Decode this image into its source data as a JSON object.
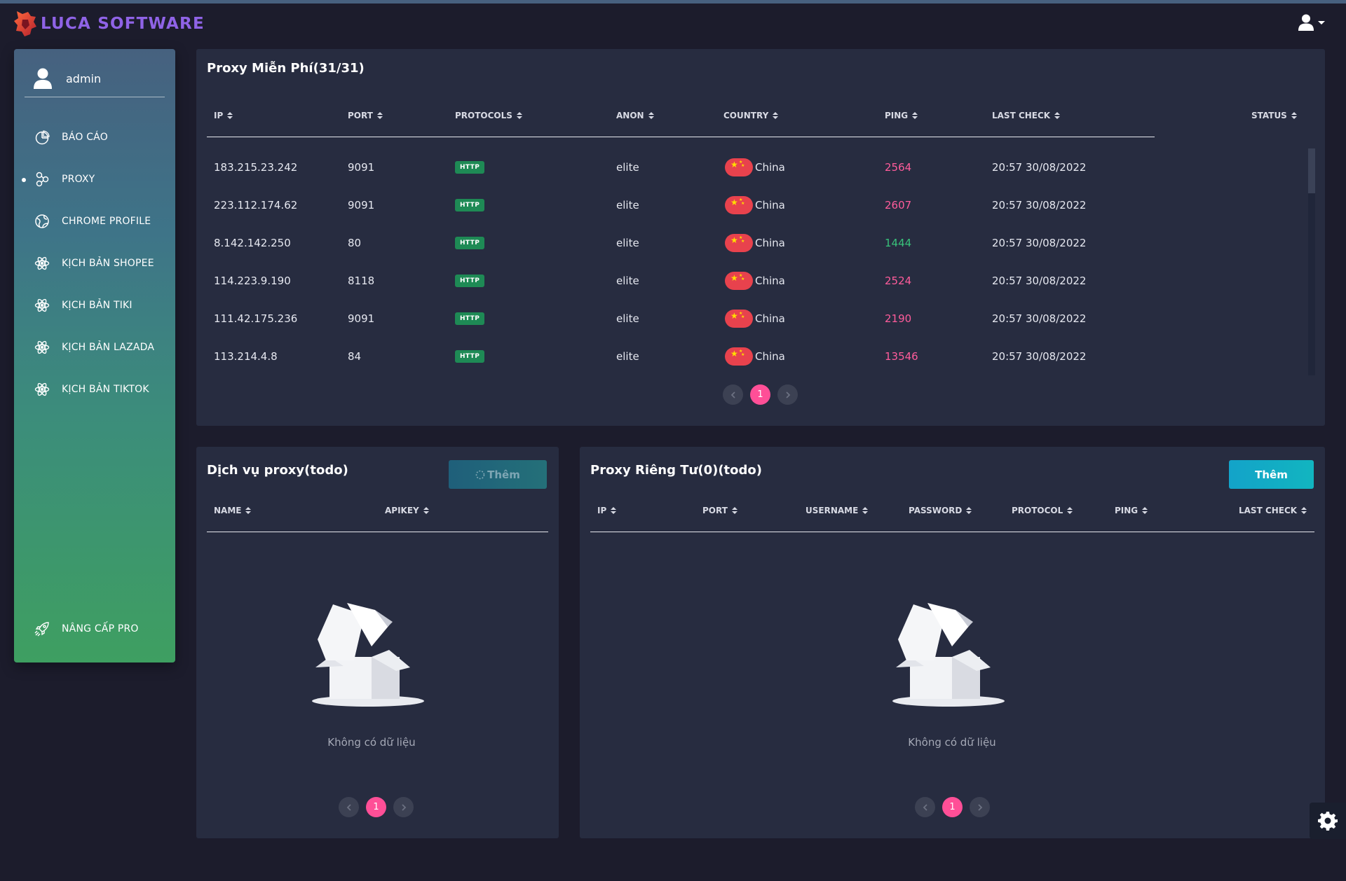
{
  "app": {
    "brand": "LUCA SOFTWARE"
  },
  "user": {
    "name": "admin"
  },
  "sidebar": {
    "items": [
      {
        "label": "BÁO CÁO",
        "icon": "chart-pie-icon",
        "active": false
      },
      {
        "label": "PROXY",
        "icon": "proxy-icon",
        "active": true
      },
      {
        "label": "CHROME PROFILE",
        "icon": "globe-icon",
        "active": false
      },
      {
        "label": "KỊCH BẢN SHOPEE",
        "icon": "atom-icon",
        "active": false
      },
      {
        "label": "KỊCH BẢN TIKI",
        "icon": "atom-icon",
        "active": false
      },
      {
        "label": "KỊCH BẢN LAZADA",
        "icon": "atom-icon",
        "active": false
      },
      {
        "label": "KỊCH BẢN TIKTOK",
        "icon": "atom-icon",
        "active": false
      }
    ],
    "pro": {
      "label": "NÂNG CẤP PRO",
      "icon": "rocket-icon"
    }
  },
  "free_proxy": {
    "title": "Proxy Miễn Phí(31/31)",
    "columns": [
      "IP",
      "PORT",
      "PROTOCOLS",
      "ANON",
      "COUNTRY",
      "PING",
      "LAST CHECK",
      "STATUS"
    ],
    "rows": [
      {
        "ip": "183.215.23.242",
        "port": "9091",
        "protocol": "HTTP",
        "anon": "elite",
        "country": "China",
        "ping": "2564",
        "ping_status": "slow",
        "last_check": "20:57 30/08/2022"
      },
      {
        "ip": "223.112.174.62",
        "port": "9091",
        "protocol": "HTTP",
        "anon": "elite",
        "country": "China",
        "ping": "2607",
        "ping_status": "slow",
        "last_check": "20:57 30/08/2022"
      },
      {
        "ip": "8.142.142.250",
        "port": "80",
        "protocol": "HTTP",
        "anon": "elite",
        "country": "China",
        "ping": "1444",
        "ping_status": "fast",
        "last_check": "20:57 30/08/2022"
      },
      {
        "ip": "114.223.9.190",
        "port": "8118",
        "protocol": "HTTP",
        "anon": "elite",
        "country": "China",
        "ping": "2524",
        "ping_status": "slow",
        "last_check": "20:57 30/08/2022"
      },
      {
        "ip": "111.42.175.236",
        "port": "9091",
        "protocol": "HTTP",
        "anon": "elite",
        "country": "China",
        "ping": "2190",
        "ping_status": "slow",
        "last_check": "20:57 30/08/2022"
      },
      {
        "ip": "113.214.4.8",
        "port": "84",
        "protocol": "HTTP",
        "anon": "elite",
        "country": "China",
        "ping": "13546",
        "ping_status": "slow",
        "last_check": "20:57 30/08/2022"
      }
    ],
    "pagination": {
      "current": "1"
    }
  },
  "proxy_service": {
    "title": "Dịch vụ proxy(todo)",
    "add_label": "Thêm",
    "columns": [
      "NAME",
      "APIKEY"
    ],
    "empty_text": "Không có dữ liệu",
    "pagination": {
      "current": "1"
    }
  },
  "private_proxy": {
    "title": "Proxy Riêng Tư(0)(todo)",
    "add_label": "Thêm",
    "columns": [
      "IP",
      "PORT",
      "USERNAME",
      "PASSWORD",
      "PROTOCOL",
      "PING",
      "LAST CHECK"
    ],
    "empty_text": "Không có dữ liệu",
    "pagination": {
      "current": "1"
    }
  },
  "colors": {
    "background": "#1c1c2c",
    "card": "#272c40",
    "accent_pink": "#ff4f97",
    "ping_slow": "#ff5c9b",
    "ping_fast": "#38c27a",
    "http_badge": "#1e8a55",
    "add_button": "#13a3c9"
  }
}
